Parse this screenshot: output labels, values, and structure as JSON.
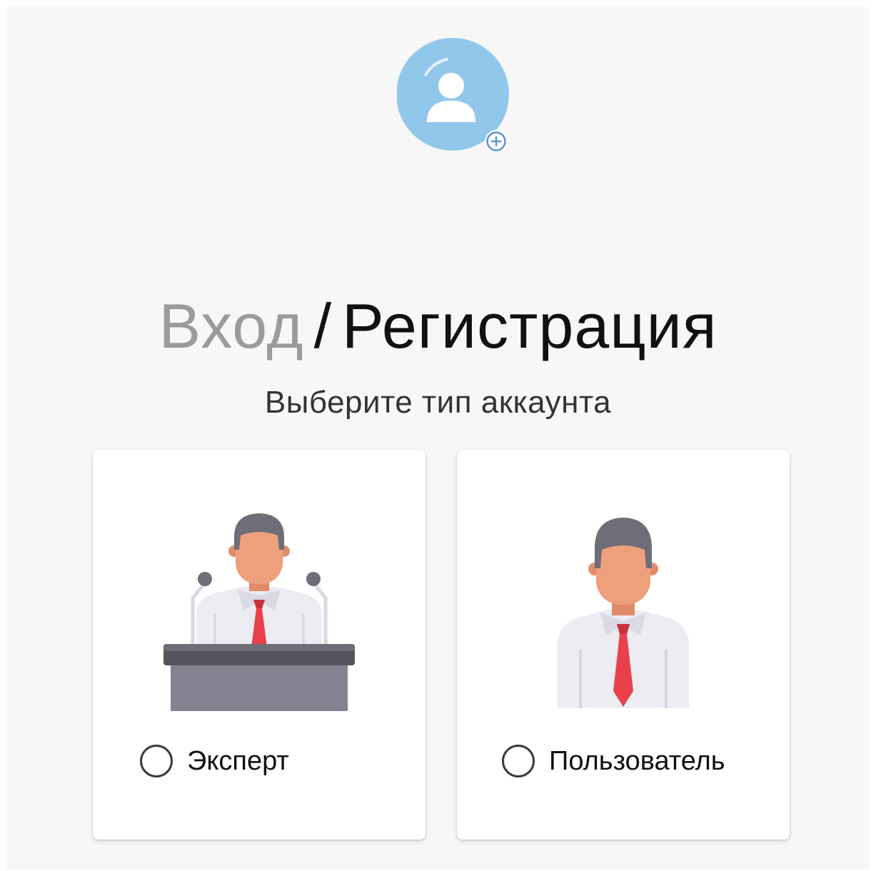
{
  "header": {
    "login_tab": "Вход",
    "separator": "/",
    "register_tab": "Регистрация"
  },
  "subtitle": "Выберите тип аккаунта",
  "avatar": {
    "icon": "user-avatar-icon",
    "badge_icon": "plus-circle-icon",
    "color": "#92c7ec"
  },
  "account_types": [
    {
      "label": "Эксперт",
      "icon": "speaker-at-podium-icon",
      "selected": false
    },
    {
      "label": "Пользователь",
      "icon": "person-with-tie-icon",
      "selected": false
    }
  ],
  "colors": {
    "background": "#f7f7f7",
    "card": "#ffffff",
    "muted_text": "#9b9b9b",
    "text": "#111111",
    "tie": "#e8414c",
    "hair": "#6e6e78",
    "skin": "#ee9f7c"
  }
}
